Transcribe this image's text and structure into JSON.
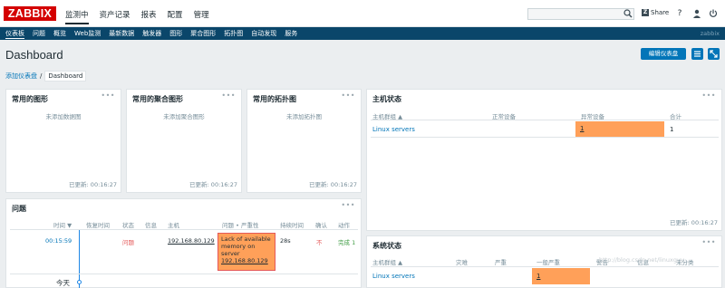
{
  "logo": "ZABBIX",
  "mainmenu": [
    "监测中",
    "资产记录",
    "报表",
    "配置",
    "管理"
  ],
  "share": "Share",
  "help": "?",
  "submenu": [
    "仪表板",
    "问题",
    "概览",
    "Web监测",
    "最新数据",
    "触发器",
    "图形",
    "聚合图形",
    "拓扑图",
    "自动发现",
    "服务"
  ],
  "subbar_right": "zabbix",
  "page_title": "Dashboard",
  "edit_button": "编辑仪表盘",
  "breadcrumb": {
    "parent": "添加仪表盘",
    "separator": "/",
    "current": "Dashboard"
  },
  "widgets": {
    "graphs": {
      "title": "常用的图形",
      "empty": "未添加数据图",
      "updated": "已更新: 00:16:27"
    },
    "screens": {
      "title": "常用的聚合图形",
      "empty": "未添加聚合图形",
      "updated": "已更新: 00:16:27"
    },
    "maps": {
      "title": "常用的拓扑图",
      "empty": "未添加拓扑图",
      "updated": "已更新: 00:16:27"
    },
    "host_status": {
      "title": "主机状态",
      "headers": [
        "主机群组 ▲",
        "正常设备",
        "异常设备",
        "合计"
      ],
      "row": {
        "group": "Linux servers",
        "ok": "",
        "problem": "1",
        "total": "1"
      },
      "updated": "已更新: 00:16:27"
    },
    "problems": {
      "title": "问题",
      "headers": [
        "时间 ▼",
        "恢复时间",
        "状态",
        "信息",
        "主机",
        "问题 • 严重性",
        "持续时间",
        "确认",
        "动作"
      ],
      "row": {
        "time": "00:15:59",
        "status": "问题",
        "host": "192.168.80.129",
        "problem_lines": [
          "Lack of available",
          "memory on",
          "server",
          "192.168.80.129"
        ],
        "duration": "28s",
        "ack": "不",
        "action": "完成 1"
      },
      "today": "今天"
    },
    "system_status": {
      "title": "系统状态",
      "headers": [
        "主机群组 ▲",
        "灾难",
        "严重",
        "一般严重",
        "警告",
        "信息",
        "未分类"
      ],
      "row": {
        "group": "Linux servers",
        "average": "1"
      },
      "watermark": "http://blog.csdn.net/linuxguy"
    }
  },
  "colors": {
    "brand": "#d40000",
    "nav": "#0a466a",
    "accent": "#0275b8",
    "problem": "#ffa059",
    "high": "#e45959"
  }
}
